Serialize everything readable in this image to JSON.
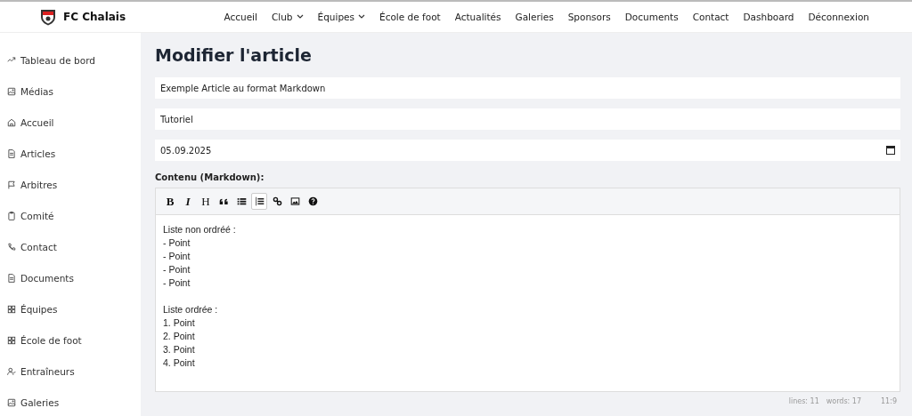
{
  "brand": {
    "name": "FC Chalais"
  },
  "nav": [
    {
      "label": "Accueil",
      "dropdown": false
    },
    {
      "label": "Club",
      "dropdown": true
    },
    {
      "label": "Équipes",
      "dropdown": true
    },
    {
      "label": "École de foot",
      "dropdown": false
    },
    {
      "label": "Actualités",
      "dropdown": false
    },
    {
      "label": "Galeries",
      "dropdown": false
    },
    {
      "label": "Sponsors",
      "dropdown": false
    },
    {
      "label": "Documents",
      "dropdown": false
    },
    {
      "label": "Contact",
      "dropdown": false
    },
    {
      "label": "Dashboard",
      "dropdown": false
    },
    {
      "label": "Déconnexion",
      "dropdown": false
    }
  ],
  "sidebar": {
    "items": [
      {
        "label": "Tableau de bord",
        "kind": "trend"
      },
      {
        "label": "Médias",
        "kind": "image"
      },
      {
        "label": "Accueil",
        "kind": "home"
      },
      {
        "label": "Articles",
        "kind": "doc"
      },
      {
        "label": "Arbitres",
        "kind": "flag"
      },
      {
        "label": "Comité",
        "kind": "clipboard"
      },
      {
        "label": "Contact",
        "kind": "phone"
      },
      {
        "label": "Documents",
        "kind": "doc"
      },
      {
        "label": "Équipes",
        "kind": "grid"
      },
      {
        "label": "École de foot",
        "kind": "grid"
      },
      {
        "label": "Entraîneurs",
        "kind": "user"
      },
      {
        "label": "Galeries",
        "kind": "image"
      }
    ]
  },
  "page": {
    "title": "Modifier l'article"
  },
  "form": {
    "title_value": "Exemple Article au format Markdown",
    "category_value": "Tutoriel",
    "date_value": "05.09.2025",
    "content_label": "Contenu (Markdown):"
  },
  "editor": {
    "toolbar": [
      {
        "kind": "bold",
        "label": "B",
        "selected": false
      },
      {
        "kind": "italic",
        "label": "I",
        "selected": false
      },
      {
        "kind": "heading",
        "label": "H",
        "selected": false
      },
      {
        "kind": "quote",
        "selected": false
      },
      {
        "kind": "ul",
        "selected": false
      },
      {
        "kind": "ol",
        "selected": true
      },
      {
        "kind": "link",
        "selected": false
      },
      {
        "kind": "image",
        "selected": false
      },
      {
        "kind": "help",
        "selected": false
      }
    ],
    "content": "Liste non ordréé :\n- Point\n- Point\n- Point\n- Point\n\nListe ordrée :\n1. Point\n2. Point\n3. Point\n4. Point",
    "status": {
      "lines": "lines: 11",
      "words": "words: 17",
      "cursor": "11:9"
    }
  }
}
